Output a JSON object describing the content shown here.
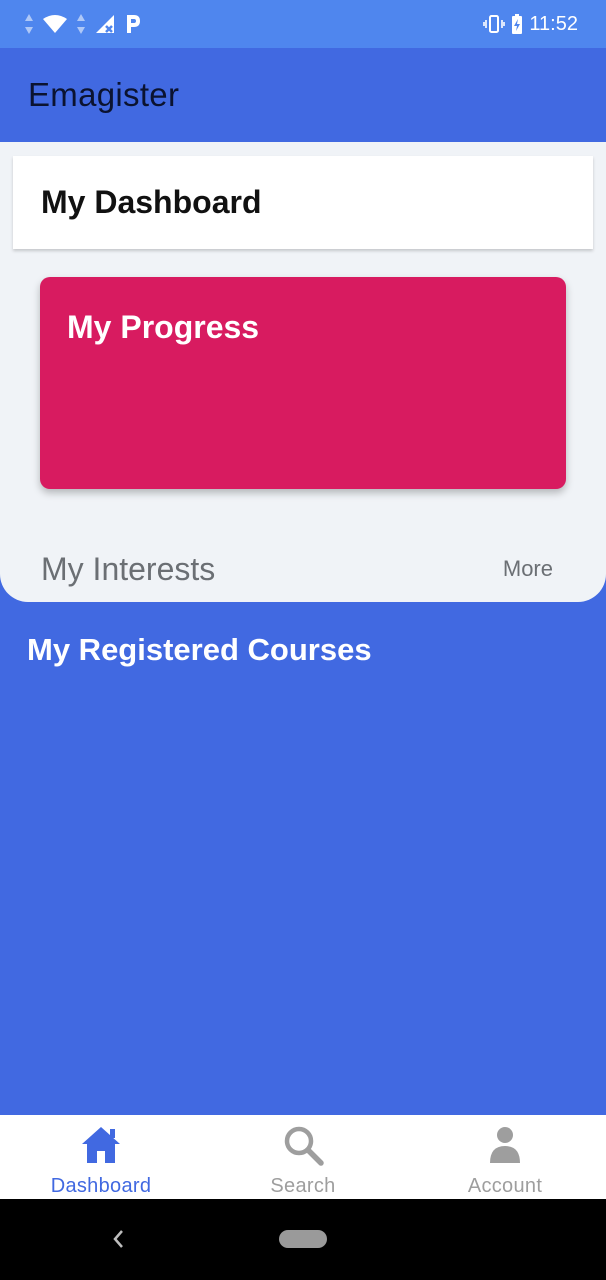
{
  "status_bar": {
    "time": "11:52",
    "icons": [
      "data-arrows-icon",
      "wifi-icon",
      "data-arrows-icon",
      "signal-no-service-icon",
      "parking-icon",
      "vibrate-icon",
      "battery-charging-icon"
    ]
  },
  "app_bar": {
    "title": "Emagister"
  },
  "dashboard": {
    "title": "My Dashboard"
  },
  "progress": {
    "title": "My Progress",
    "color": "#D81B60"
  },
  "interests": {
    "title": "My Interests",
    "more_label": "More"
  },
  "registered": {
    "title": "My Registered Courses"
  },
  "bottom_nav": {
    "items": [
      {
        "label": "Dashboard",
        "icon": "home-icon",
        "active": true
      },
      {
        "label": "Search",
        "icon": "search-icon",
        "active": false
      },
      {
        "label": "Account",
        "icon": "account-icon",
        "active": false
      }
    ]
  },
  "colors": {
    "primary": "#4169E1",
    "status_bar": "#4F86EE",
    "panel": "#F0F3F7",
    "accent": "#D81B60"
  }
}
